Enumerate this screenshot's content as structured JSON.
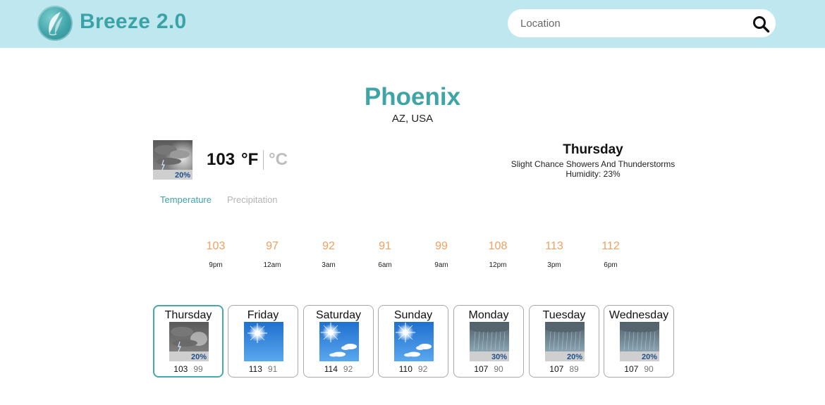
{
  "header": {
    "brand": "Breeze 2.0",
    "search_placeholder": "Location",
    "bg_color": "#bfe7ef",
    "accent_color": "#3aa3a6"
  },
  "location": {
    "city": "Phoenix",
    "region": "AZ, USA"
  },
  "current": {
    "icon": "thunderstorm-icon",
    "precip_chance": "20%",
    "temperature": "103",
    "unit_f": "°F",
    "unit_c": "°C",
    "day": "Thursday",
    "condition": "Slight Chance Showers And Thunderstorms",
    "humidity": "Humidity: 23%"
  },
  "tabs": [
    {
      "label": "Temperature",
      "active": true
    },
    {
      "label": "Precipitation",
      "active": false
    }
  ],
  "hourly": [
    {
      "temp": "103",
      "time": "9pm"
    },
    {
      "temp": "97",
      "time": "12am"
    },
    {
      "temp": "92",
      "time": "3am"
    },
    {
      "temp": "91",
      "time": "6am"
    },
    {
      "temp": "99",
      "time": "9am"
    },
    {
      "temp": "108",
      "time": "12pm"
    },
    {
      "temp": "113",
      "time": "3pm"
    },
    {
      "temp": "112",
      "time": "6pm"
    }
  ],
  "daily": [
    {
      "day": "Thursday",
      "icon": "thunderstorm-icon",
      "precip": "20%",
      "high": "103",
      "low": "99",
      "active": true
    },
    {
      "day": "Friday",
      "icon": "sunny-icon",
      "precip": "",
      "high": "113",
      "low": "91",
      "active": false
    },
    {
      "day": "Saturday",
      "icon": "sunny-cloud-icon",
      "precip": "",
      "high": "114",
      "low": "92",
      "active": false
    },
    {
      "day": "Sunday",
      "icon": "sunny-cloud-icon",
      "precip": "",
      "high": "110",
      "low": "92",
      "active": false
    },
    {
      "day": "Monday",
      "icon": "rain-icon",
      "precip": "30%",
      "high": "107",
      "low": "90",
      "active": false
    },
    {
      "day": "Tuesday",
      "icon": "rain-icon",
      "precip": "20%",
      "high": "107",
      "low": "89",
      "active": false
    },
    {
      "day": "Wednesday",
      "icon": "rain-icon",
      "precip": "20%",
      "high": "107",
      "low": "90",
      "active": false
    }
  ]
}
